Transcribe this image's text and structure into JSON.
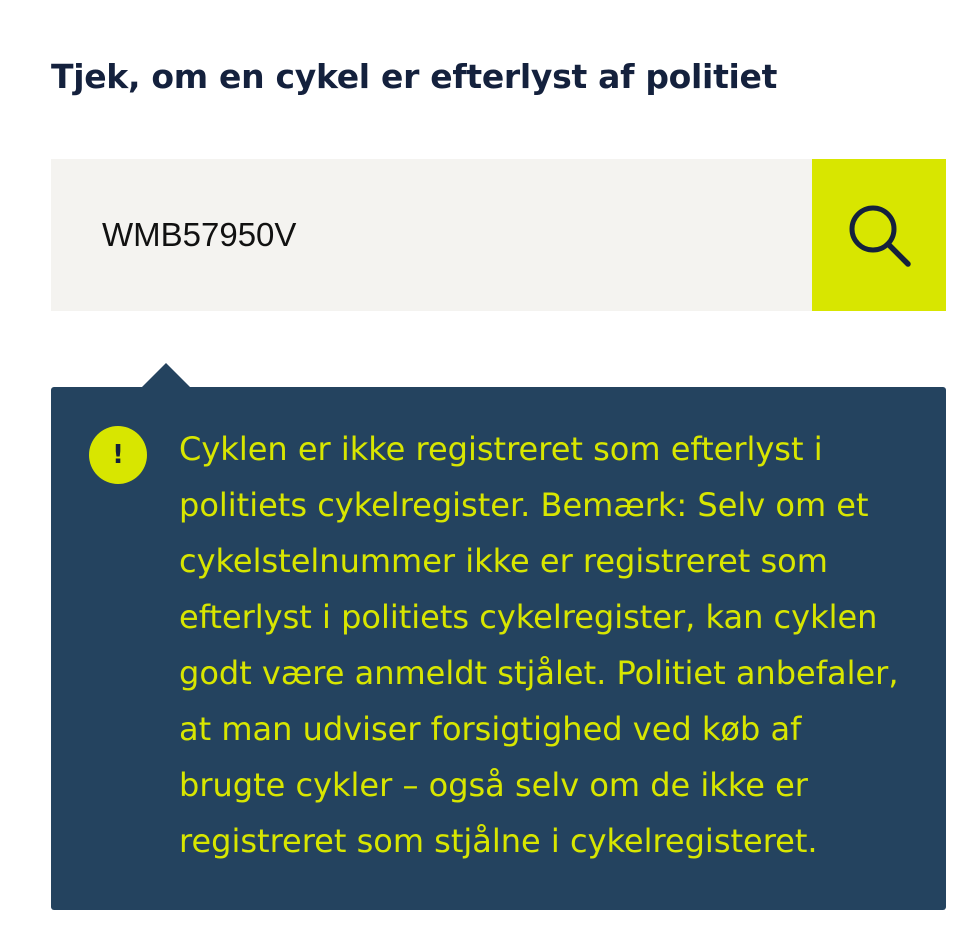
{
  "page": {
    "title": "Tjek, om en cykel er efterlyst af politiet"
  },
  "search": {
    "value": "WMB57950V",
    "button_icon": "search-icon",
    "accent_color": "#d8e600",
    "input_background": "#f4f3f0"
  },
  "notice": {
    "icon": "exclamation-icon",
    "icon_glyph": "!",
    "background_color": "#24435f",
    "text_color": "#d8e600",
    "message": "Cyklen er ikke registreret som efterlyst i politiets cykelregister. Bemærk: Selv om et cykelstelnummer ikke er registreret som efterlyst i politiets cykelregister, kan cyklen godt være anmeldt stjålet. Politiet anbefaler, at man udviser forsigtighed ved køb af brugte cykler – også selv om de ikke er registreret som stjålne i cykelregisteret."
  }
}
